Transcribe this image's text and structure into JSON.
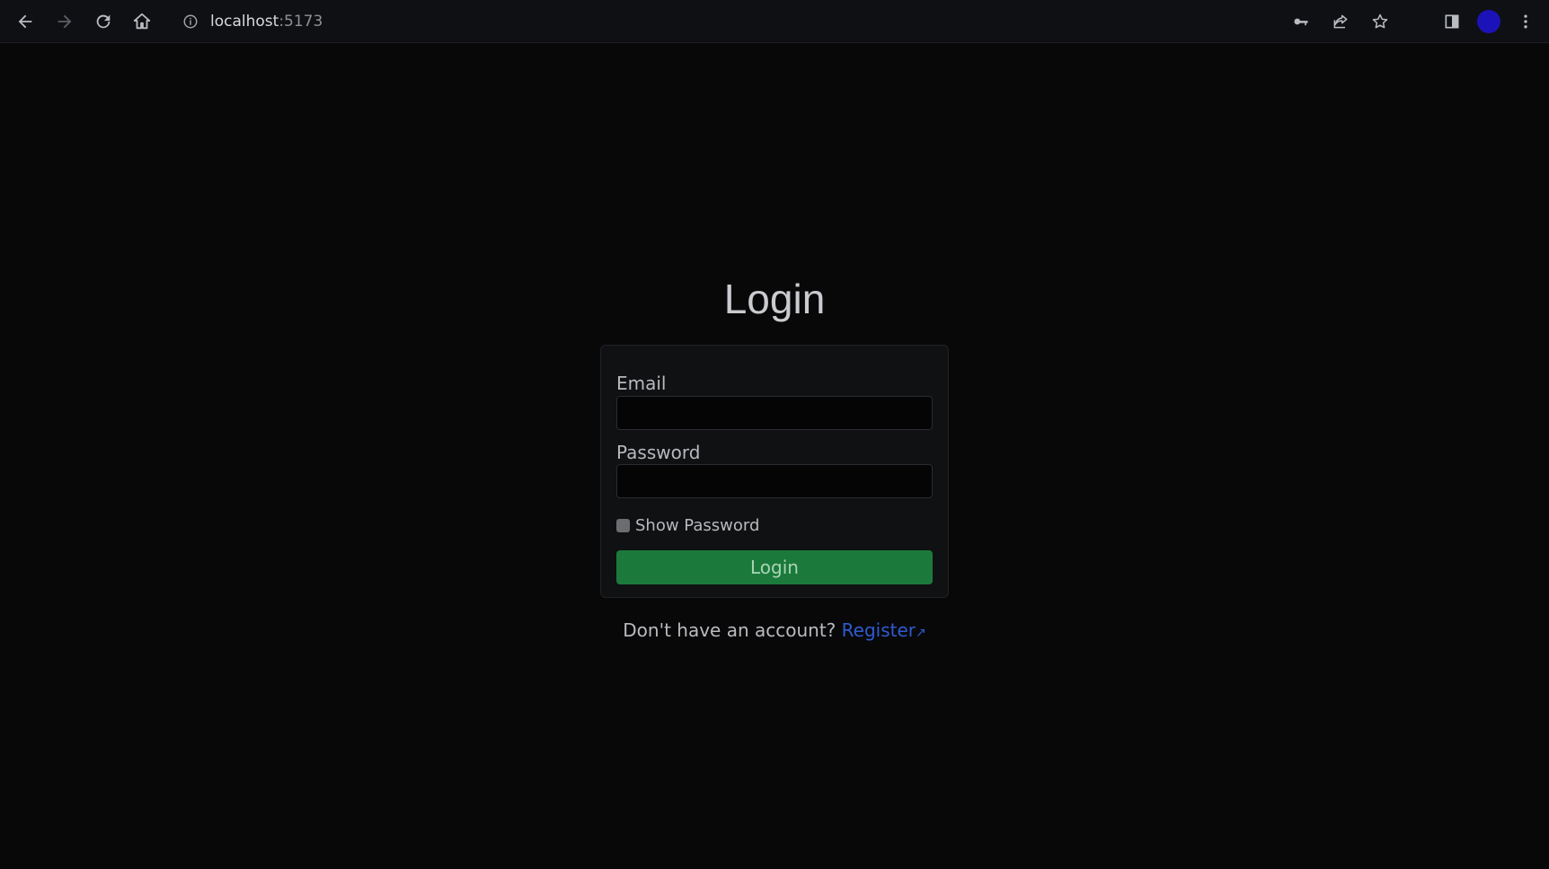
{
  "browser": {
    "url_host": "localhost",
    "url_port": ":5173",
    "icons": [
      "back-icon",
      "forward-icon",
      "reload-icon",
      "home-icon",
      "info-icon",
      "key-icon",
      "share-icon",
      "star-icon",
      "side-panel-icon",
      "profile-avatar",
      "kebab-menu-icon"
    ],
    "avatar_color": "#1b13b8"
  },
  "page": {
    "title": "Login",
    "form": {
      "email_label": "Email",
      "email_value": "",
      "password_label": "Password",
      "password_value": "",
      "show_password_label": "Show Password",
      "show_password_checked": false,
      "submit_label": "Login",
      "submit_color": "#1b7a3b"
    },
    "register_prompt": "Don't have an account?",
    "register_link": "Register",
    "link_color": "#2f5bd0"
  }
}
